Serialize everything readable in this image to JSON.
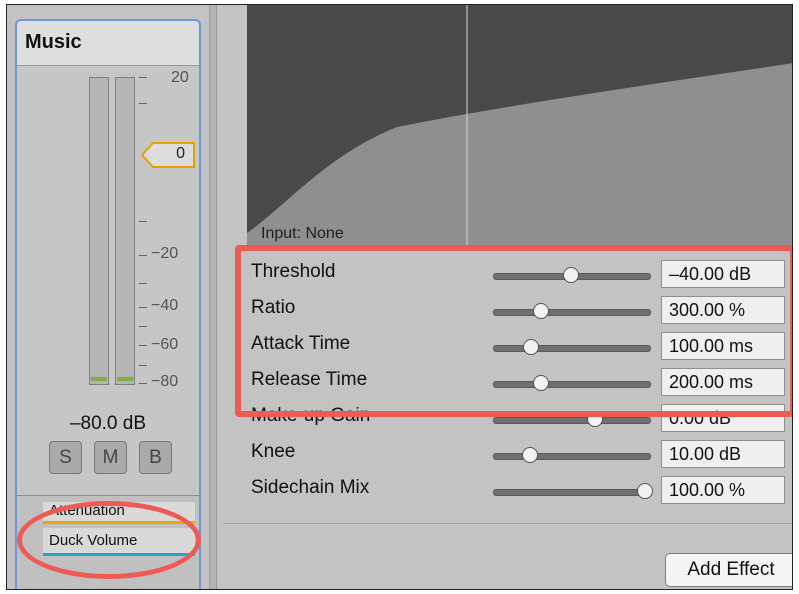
{
  "mixer_strip": {
    "title": "Music",
    "scale_labels": [
      "20",
      "−20",
      "−40",
      "−60",
      "−80"
    ],
    "fader_value": "0",
    "volume_readout": "–80.0 dB",
    "buttons": [
      "S",
      "M",
      "B"
    ],
    "effects": [
      "Attenuation",
      "Duck Volume"
    ]
  },
  "effect_panel": {
    "graph_label": "Input: None",
    "parameters": [
      {
        "label": "Threshold",
        "value": "–40.00 dB",
        "slider": 0.5
      },
      {
        "label": "Ratio",
        "value": "300.00 %",
        "slider": 0.3
      },
      {
        "label": "Attack Time",
        "value": "100.00 ms",
        "slider": 0.23
      },
      {
        "label": "Release Time",
        "value": "200.00 ms",
        "slider": 0.3
      },
      {
        "label": "Make-up Gain",
        "value": "0.00 dB",
        "slider": 0.66
      },
      {
        "label": "Knee",
        "value": "10.00 dB",
        "slider": 0.22
      },
      {
        "label": "Sidechain Mix",
        "value": "100.00 %",
        "slider": 1.0
      }
    ],
    "add_effect_label": "Add Effect"
  },
  "colors": {
    "highlight": "#ee5b55",
    "strip_border": "#6d97d6",
    "attenuation_bar": "#e8a800",
    "duck_bar": "#20a9c4",
    "meter_level": "#7fae44"
  }
}
